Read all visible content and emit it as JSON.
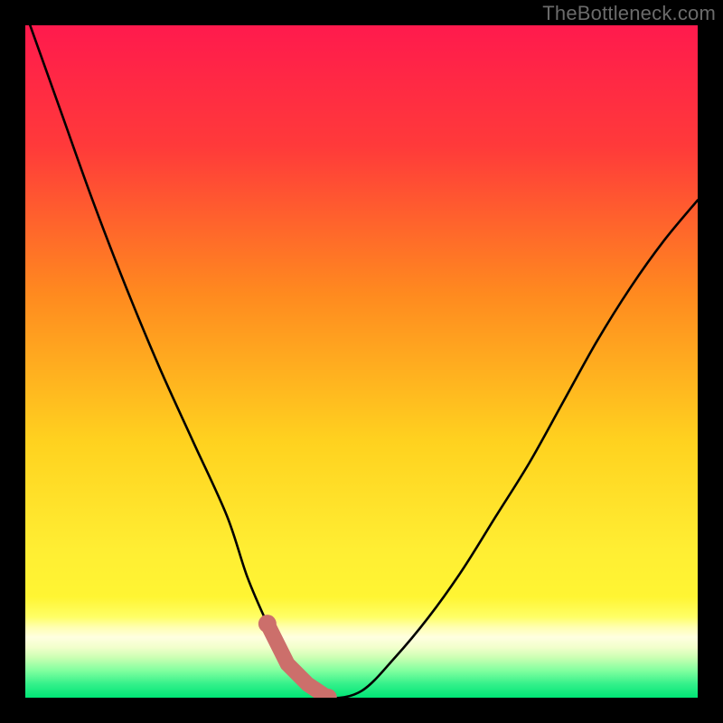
{
  "watermark": "TheBottleneck.com",
  "chart_data": {
    "type": "line",
    "title": "",
    "xlabel": "",
    "ylabel": "",
    "xlim": [
      0,
      100
    ],
    "ylim": [
      0,
      100
    ],
    "grid": false,
    "series": [
      {
        "name": "curve",
        "x": [
          0,
          5,
          10,
          15,
          20,
          25,
          30,
          33,
          36,
          39,
          42,
          45,
          50,
          55,
          60,
          65,
          70,
          75,
          80,
          85,
          90,
          95,
          100
        ],
        "y": [
          102,
          88,
          74,
          61,
          49,
          38,
          27,
          18,
          11,
          5,
          2,
          0,
          1,
          6,
          12,
          19,
          27,
          35,
          44,
          53,
          61,
          68,
          74
        ]
      }
    ],
    "marker_region": {
      "comment": "coral highlight near the minimum of the curve",
      "x_start": 36,
      "x_end": 49,
      "y_level": 1
    },
    "gradient": {
      "top_color": "#ff1a4d",
      "mid_color": "#ffe600",
      "band_color": "#ffff99",
      "bottom_color": "#00e676"
    },
    "colors": {
      "curve": "#000000",
      "marker": "#cc6f6b",
      "frame": "#000000"
    }
  }
}
